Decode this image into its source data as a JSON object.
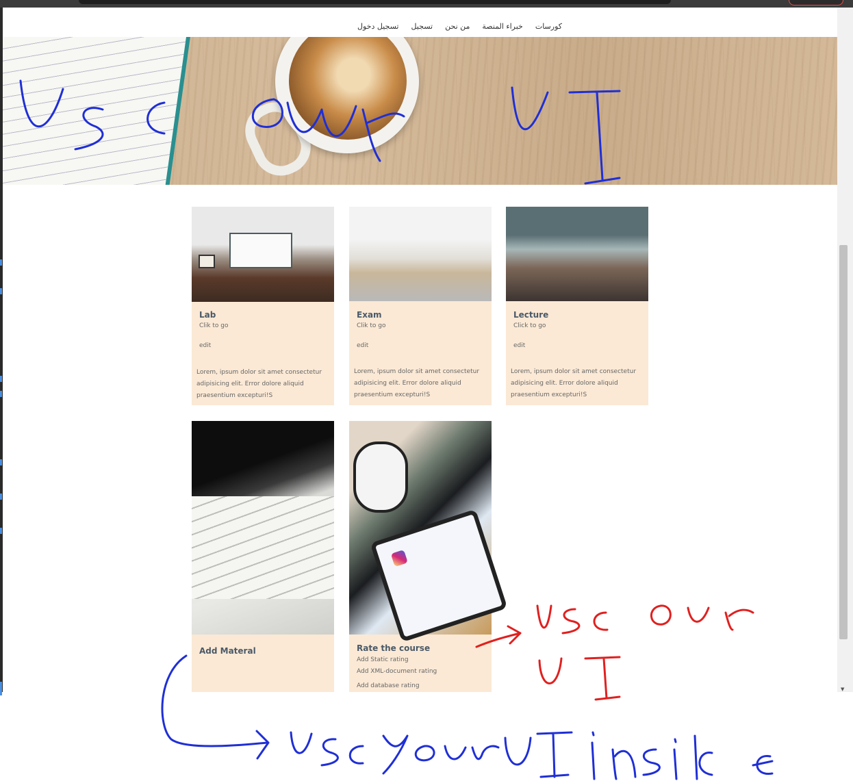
{
  "nav": {
    "links": [
      "تسجيل دخول",
      "تسجيل",
      "من نحن",
      "خبراء المنصة",
      "كورسات"
    ]
  },
  "cards": [
    {
      "title": "Lab",
      "subtitle": "Clik to go",
      "edit": "edit",
      "desc": "Lorem, ipsum dolor sit amet consectetur adipisicing elit. Error dolore aliquid praesentium excepturi!S"
    },
    {
      "title": "Exam",
      "subtitle": "Clik to go",
      "edit": "edit",
      "desc": "Lorem, ipsum dolor sit amet consectetur adipisicing elit. Error dolore aliquid praesentium excepturi!S"
    },
    {
      "title": "Lecture",
      "subtitle": "Click to go",
      "edit": "edit",
      "desc": "Lorem, ipsum dolor sit amet consectetur adipisicing elit. Error dolore aliquid praesentium excepturi!S"
    }
  ],
  "material_card": {
    "title": "Add Materal"
  },
  "rate_card": {
    "title": "Rate the course",
    "items": [
      "Add Static rating",
      "Add XML-document rating",
      "Add database rating"
    ]
  },
  "colors": {
    "card_bg": "#fbe9d5",
    "title_text": "#4a5968",
    "annotation_blue": "#1f2fd6",
    "annotation_red": "#e0201f"
  },
  "annotations": [
    {
      "text": "Use our UI",
      "color": "blue"
    },
    {
      "text": "Use our UI",
      "color": "red"
    },
    {
      "text": "use your UI inside",
      "color": "blue"
    }
  ]
}
